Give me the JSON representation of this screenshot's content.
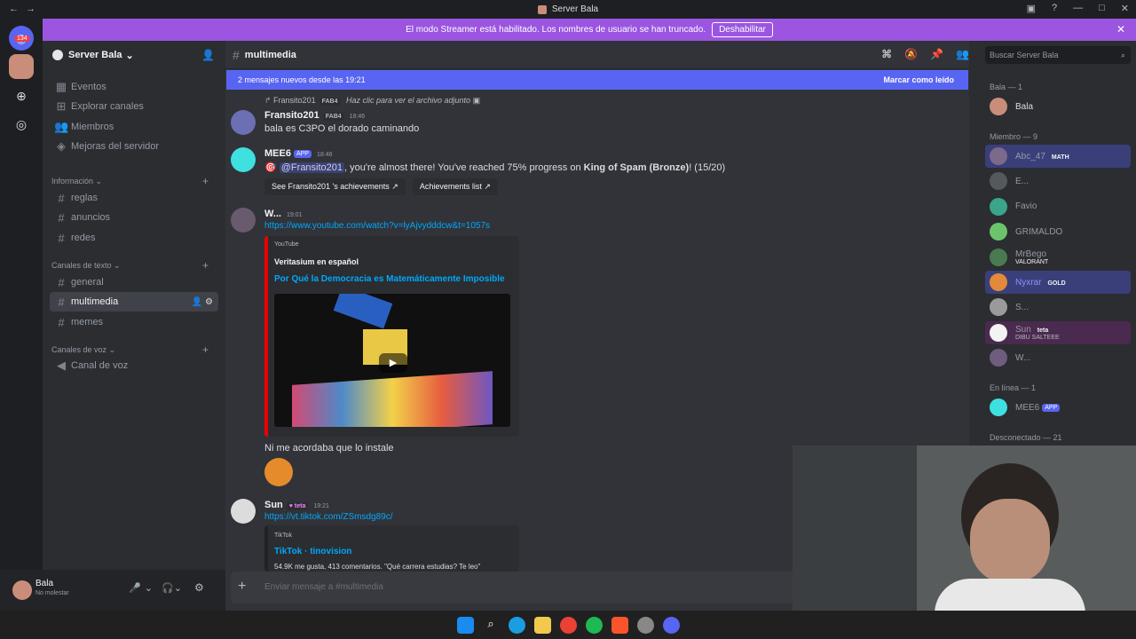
{
  "titlebar": {
    "title": "Server Bala"
  },
  "guilds": {
    "badge": "134"
  },
  "banner": {
    "text": "El modo Streamer está habilitado. Los nombres de usuario se han truncado.",
    "button": "Deshabilitar"
  },
  "server": {
    "name": "Server Bala"
  },
  "nav": [
    {
      "label": "Eventos"
    },
    {
      "label": "Explorar canales"
    },
    {
      "label": "Miembros"
    },
    {
      "label": "Mejoras del servidor"
    }
  ],
  "categories": {
    "info": "Información",
    "text": "Canales de texto",
    "voice": "Canales de voz"
  },
  "channels": {
    "info": [
      "reglas",
      "anuncios",
      "redes"
    ],
    "text": [
      "general",
      "multimedia",
      "memes"
    ],
    "voice": [
      "Canal de voz"
    ]
  },
  "user": {
    "name": "Bala",
    "status": "No molestar"
  },
  "channel": {
    "name": "multimedia"
  },
  "newbar": {
    "text": "2 mensajes nuevos desde las 19:21",
    "mark": "Marcar como leído"
  },
  "messages": {
    "reply": {
      "user": "Fransito201",
      "tag": "FAB4",
      "text": "Haz clic para ver el archivo adjunto"
    },
    "m1": {
      "user": "Fransito201",
      "tag": "FAB4",
      "time": "18:46",
      "text": "bala es C3PO el dorado caminando"
    },
    "m2": {
      "user": "MEE6",
      "badge": "APP",
      "time": "18:46",
      "mention": "@Fransito201",
      "text": ", you're almost there! You've reached 75% progress on ",
      "bold": "King of Spam (Bronze)",
      "tail": "! (15/20)",
      "btn1": "See Fransito201 's achievements",
      "btn2": "Achievements list"
    },
    "m3": {
      "user": "W...",
      "time": "19:01",
      "link": "https://www.youtube.com/watch?v=lyAjvydddcw&t=1057s",
      "provider": "YouTube",
      "author": "Veritasium en español",
      "title": "Por Qué la Democracia es Matemáticamente Imposible",
      "text2": "Ni me acordaba que lo instale"
    },
    "m4": {
      "user": "Sun",
      "tag": "teta",
      "time": "19:21",
      "link": "https://vt.tiktok.com/ZSmsdg89c/",
      "provider": "TikTok",
      "title": "TikTok · tinovision",
      "desc": "54.9K me gusta, 413 comentarios. \"Qué carrera estudias? Te leo\""
    }
  },
  "composer": {
    "placeholder": "Enviar mensaje a #multimedia"
  },
  "search": {
    "placeholder": "Buscar Server Bala"
  },
  "members": {
    "cat1": "Bala — 1",
    "cat2": "Miembro — 9",
    "cat3": "En línea — 1",
    "cat4": "Desconectado — 21",
    "owner": [
      {
        "name": "Bala",
        "color": "#c9cdfb"
      }
    ],
    "list": [
      {
        "name": "Abc_47",
        "tag": "MATH",
        "color": "#949ba4"
      },
      {
        "name": "E...",
        "tag": "",
        "color": "#949ba4"
      },
      {
        "name": "Favio",
        "tag": "",
        "color": "#949ba4"
      },
      {
        "name": "GRIMALDO",
        "tag": "",
        "color": "#949ba4"
      },
      {
        "name": "MrBego",
        "tag": "VALORANT",
        "color": "#949ba4"
      },
      {
        "name": "Nyxrar",
        "tag": "GOLD",
        "color": "#8b93ff"
      },
      {
        "name": "S...",
        "tag": "",
        "color": "#949ba4"
      },
      {
        "name": "Sun",
        "tag": "teta",
        "sub": "DIBU SALTEEE",
        "color": "#949ba4"
      },
      {
        "name": "W...",
        "tag": "",
        "color": "#949ba4"
      }
    ],
    "online": [
      {
        "name": "MEE6",
        "badge": "APP",
        "color": "#949ba4"
      }
    ]
  }
}
